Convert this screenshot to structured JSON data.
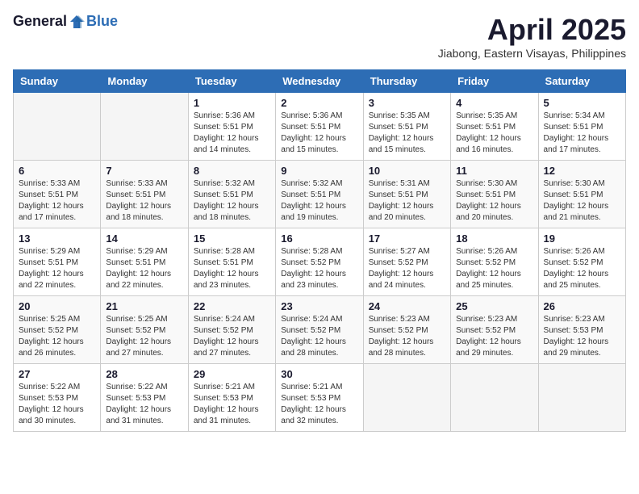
{
  "header": {
    "logo_general": "General",
    "logo_blue": "Blue",
    "month_title": "April 2025",
    "location": "Jiabong, Eastern Visayas, Philippines"
  },
  "calendar": {
    "days_of_week": [
      "Sunday",
      "Monday",
      "Tuesday",
      "Wednesday",
      "Thursday",
      "Friday",
      "Saturday"
    ],
    "weeks": [
      [
        {
          "day": "",
          "info": ""
        },
        {
          "day": "",
          "info": ""
        },
        {
          "day": "1",
          "info": "Sunrise: 5:36 AM\nSunset: 5:51 PM\nDaylight: 12 hours and 14 minutes."
        },
        {
          "day": "2",
          "info": "Sunrise: 5:36 AM\nSunset: 5:51 PM\nDaylight: 12 hours and 15 minutes."
        },
        {
          "day": "3",
          "info": "Sunrise: 5:35 AM\nSunset: 5:51 PM\nDaylight: 12 hours and 15 minutes."
        },
        {
          "day": "4",
          "info": "Sunrise: 5:35 AM\nSunset: 5:51 PM\nDaylight: 12 hours and 16 minutes."
        },
        {
          "day": "5",
          "info": "Sunrise: 5:34 AM\nSunset: 5:51 PM\nDaylight: 12 hours and 17 minutes."
        }
      ],
      [
        {
          "day": "6",
          "info": "Sunrise: 5:33 AM\nSunset: 5:51 PM\nDaylight: 12 hours and 17 minutes."
        },
        {
          "day": "7",
          "info": "Sunrise: 5:33 AM\nSunset: 5:51 PM\nDaylight: 12 hours and 18 minutes."
        },
        {
          "day": "8",
          "info": "Sunrise: 5:32 AM\nSunset: 5:51 PM\nDaylight: 12 hours and 18 minutes."
        },
        {
          "day": "9",
          "info": "Sunrise: 5:32 AM\nSunset: 5:51 PM\nDaylight: 12 hours and 19 minutes."
        },
        {
          "day": "10",
          "info": "Sunrise: 5:31 AM\nSunset: 5:51 PM\nDaylight: 12 hours and 20 minutes."
        },
        {
          "day": "11",
          "info": "Sunrise: 5:30 AM\nSunset: 5:51 PM\nDaylight: 12 hours and 20 minutes."
        },
        {
          "day": "12",
          "info": "Sunrise: 5:30 AM\nSunset: 5:51 PM\nDaylight: 12 hours and 21 minutes."
        }
      ],
      [
        {
          "day": "13",
          "info": "Sunrise: 5:29 AM\nSunset: 5:51 PM\nDaylight: 12 hours and 22 minutes."
        },
        {
          "day": "14",
          "info": "Sunrise: 5:29 AM\nSunset: 5:51 PM\nDaylight: 12 hours and 22 minutes."
        },
        {
          "day": "15",
          "info": "Sunrise: 5:28 AM\nSunset: 5:51 PM\nDaylight: 12 hours and 23 minutes."
        },
        {
          "day": "16",
          "info": "Sunrise: 5:28 AM\nSunset: 5:52 PM\nDaylight: 12 hours and 23 minutes."
        },
        {
          "day": "17",
          "info": "Sunrise: 5:27 AM\nSunset: 5:52 PM\nDaylight: 12 hours and 24 minutes."
        },
        {
          "day": "18",
          "info": "Sunrise: 5:26 AM\nSunset: 5:52 PM\nDaylight: 12 hours and 25 minutes."
        },
        {
          "day": "19",
          "info": "Sunrise: 5:26 AM\nSunset: 5:52 PM\nDaylight: 12 hours and 25 minutes."
        }
      ],
      [
        {
          "day": "20",
          "info": "Sunrise: 5:25 AM\nSunset: 5:52 PM\nDaylight: 12 hours and 26 minutes."
        },
        {
          "day": "21",
          "info": "Sunrise: 5:25 AM\nSunset: 5:52 PM\nDaylight: 12 hours and 27 minutes."
        },
        {
          "day": "22",
          "info": "Sunrise: 5:24 AM\nSunset: 5:52 PM\nDaylight: 12 hours and 27 minutes."
        },
        {
          "day": "23",
          "info": "Sunrise: 5:24 AM\nSunset: 5:52 PM\nDaylight: 12 hours and 28 minutes."
        },
        {
          "day": "24",
          "info": "Sunrise: 5:23 AM\nSunset: 5:52 PM\nDaylight: 12 hours and 28 minutes."
        },
        {
          "day": "25",
          "info": "Sunrise: 5:23 AM\nSunset: 5:52 PM\nDaylight: 12 hours and 29 minutes."
        },
        {
          "day": "26",
          "info": "Sunrise: 5:23 AM\nSunset: 5:53 PM\nDaylight: 12 hours and 29 minutes."
        }
      ],
      [
        {
          "day": "27",
          "info": "Sunrise: 5:22 AM\nSunset: 5:53 PM\nDaylight: 12 hours and 30 minutes."
        },
        {
          "day": "28",
          "info": "Sunrise: 5:22 AM\nSunset: 5:53 PM\nDaylight: 12 hours and 31 minutes."
        },
        {
          "day": "29",
          "info": "Sunrise: 5:21 AM\nSunset: 5:53 PM\nDaylight: 12 hours and 31 minutes."
        },
        {
          "day": "30",
          "info": "Sunrise: 5:21 AM\nSunset: 5:53 PM\nDaylight: 12 hours and 32 minutes."
        },
        {
          "day": "",
          "info": ""
        },
        {
          "day": "",
          "info": ""
        },
        {
          "day": "",
          "info": ""
        }
      ]
    ]
  }
}
